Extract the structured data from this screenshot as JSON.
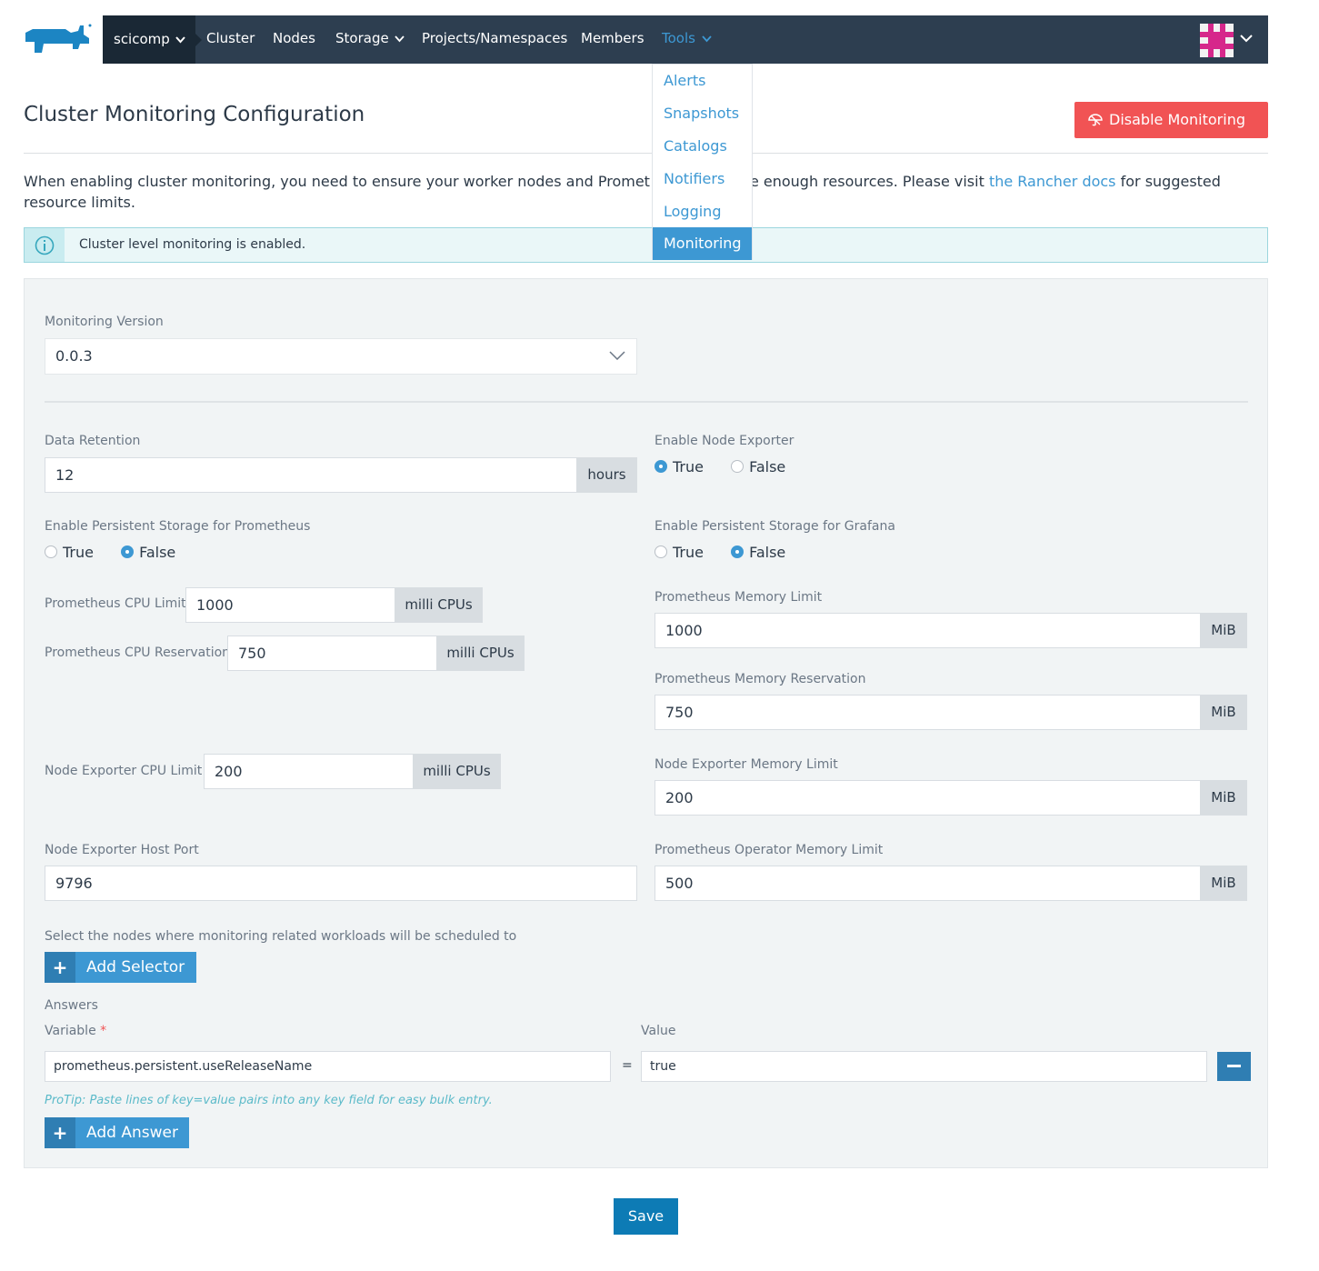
{
  "nav": {
    "cluster_name": "scicomp",
    "items": [
      "Cluster",
      "Nodes",
      "Storage",
      "Projects/Namespaces",
      "Members",
      "Tools"
    ],
    "tools_menu": [
      "Alerts",
      "Snapshots",
      "Catalogs",
      "Notifiers",
      "Logging",
      "Monitoring"
    ],
    "selected_tool": "Monitoring"
  },
  "header": {
    "title": "Cluster Monitoring Configuration",
    "disable_button": "Disable Monitoring"
  },
  "intro": {
    "text_before_gap": "When enabling cluster monitoring, you need to ensure your worker nodes and Promet",
    "text_after_gap": "e enough resources. Please visit ",
    "link": "the Rancher docs",
    "text_after_link": " for suggested",
    "line2": "resource limits."
  },
  "banner": {
    "text": "Cluster level monitoring is enabled."
  },
  "form": {
    "monitoring_version": {
      "label": "Monitoring Version",
      "value": "0.0.3"
    },
    "data_retention": {
      "label": "Data Retention",
      "value": "12",
      "unit": "hours"
    },
    "node_exporter": {
      "label": "Enable Node Exporter",
      "true_label": "True",
      "false_label": "False",
      "value": true
    },
    "persistent_prometheus": {
      "label": "Enable Persistent Storage for Prometheus",
      "true_label": "True",
      "false_label": "False",
      "value": false
    },
    "persistent_grafana": {
      "label": "Enable Persistent Storage for Grafana",
      "true_label": "True",
      "false_label": "False",
      "value": false
    },
    "prom_cpu_limit": {
      "label": "Prometheus CPU Limit",
      "value": "1000",
      "unit": "milli CPUs"
    },
    "prom_cpu_reservation": {
      "label": "Prometheus CPU Reservation",
      "value": "750",
      "unit": "milli CPUs"
    },
    "prom_mem_limit": {
      "label": "Prometheus Memory Limit",
      "value": "1000",
      "unit": "MiB"
    },
    "prom_mem_reservation": {
      "label": "Prometheus Memory Reservation",
      "value": "750",
      "unit": "MiB"
    },
    "ne_cpu_limit": {
      "label": "Node Exporter CPU Limit",
      "value": "200",
      "unit": "milli CPUs"
    },
    "ne_mem_limit": {
      "label": "Node Exporter Memory Limit",
      "value": "200",
      "unit": "MiB"
    },
    "ne_host_port": {
      "label": "Node Exporter Host Port",
      "value": "9796"
    },
    "operator_mem_limit": {
      "label": "Prometheus Operator Memory Limit",
      "value": "500",
      "unit": "MiB"
    },
    "selector_text": "Select the nodes where monitoring related workloads will be scheduled to",
    "add_selector": "Add Selector",
    "answers_label": "Answers",
    "variable_label": "Variable",
    "required_mark": "*",
    "value_label": "Value",
    "answer_row": {
      "variable": "prometheus.persistent.useReleaseName",
      "equals": "=",
      "value": "true"
    },
    "protip": "ProTip: Paste lines of key=value pairs into any key field for easy bulk entry.",
    "add_answer": "Add Answer"
  },
  "footer": {
    "save": "Save"
  },
  "colors": {
    "primary": "#3d98d3",
    "danger": "#f15354",
    "nav_bg": "#2d3e50"
  }
}
